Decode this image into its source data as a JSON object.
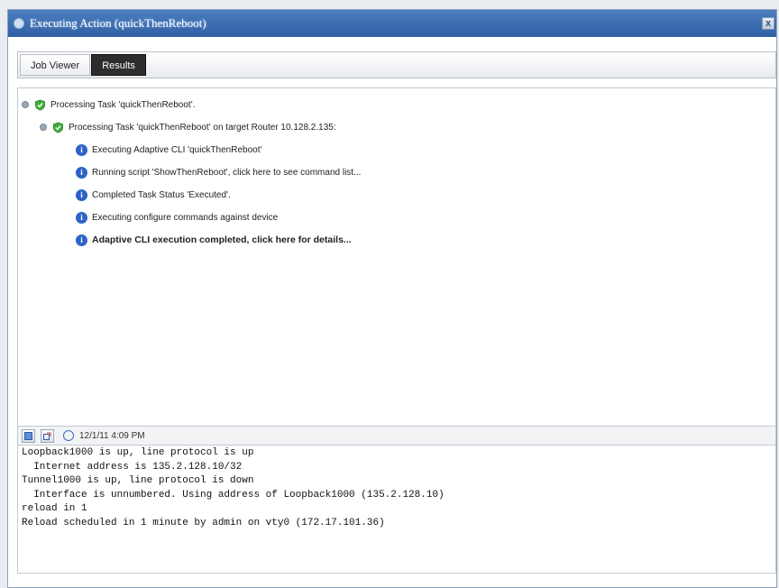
{
  "window": {
    "title": "Executing Action (quickThenReboot)",
    "close_glyph": "x"
  },
  "tabs": [
    {
      "label": "Job Viewer",
      "active": false
    },
    {
      "label": "Results",
      "active": true
    }
  ],
  "tree": {
    "items": [
      {
        "text": "Processing Task 'quickThenReboot'.",
        "icon": "shield-check-icon"
      },
      {
        "text": "Processing Task 'quickThenReboot' on target Router 10.128.2.135:",
        "icon": "shield-check-icon"
      },
      {
        "text": "Executing Adaptive CLI 'quickThenReboot'",
        "icon": "info-icon"
      },
      {
        "text": "Running script 'ShowThenReboot', click here to see command list...",
        "icon": "info-icon"
      },
      {
        "text": "Completed Task Status 'Executed'.",
        "icon": "info-icon"
      },
      {
        "text": "Executing configure commands against device",
        "icon": "info-icon"
      },
      {
        "text": "Adaptive CLI execution completed, click here for details...",
        "icon": "info-icon"
      }
    ]
  },
  "log_toolbar": {
    "timestamp": "12/1/11 4:09 PM"
  },
  "log": {
    "lines": [
      "Loopback1000 is up, line protocol is up",
      "  Internet address is 135.2.128.10/32",
      "Tunnel1000 is up, line protocol is down",
      "  Interface is unnumbered. Using address of Loopback1000 (135.2.128.10)",
      "reload in 1",
      "Reload scheduled in 1 minute by admin on vty0 (172.17.101.36)"
    ]
  },
  "colors": {
    "titlebar": "#2f5fa3",
    "active_tab": "#2d2d2d",
    "shield_green": "#3fae3a",
    "info_blue": "#2f62c8"
  }
}
